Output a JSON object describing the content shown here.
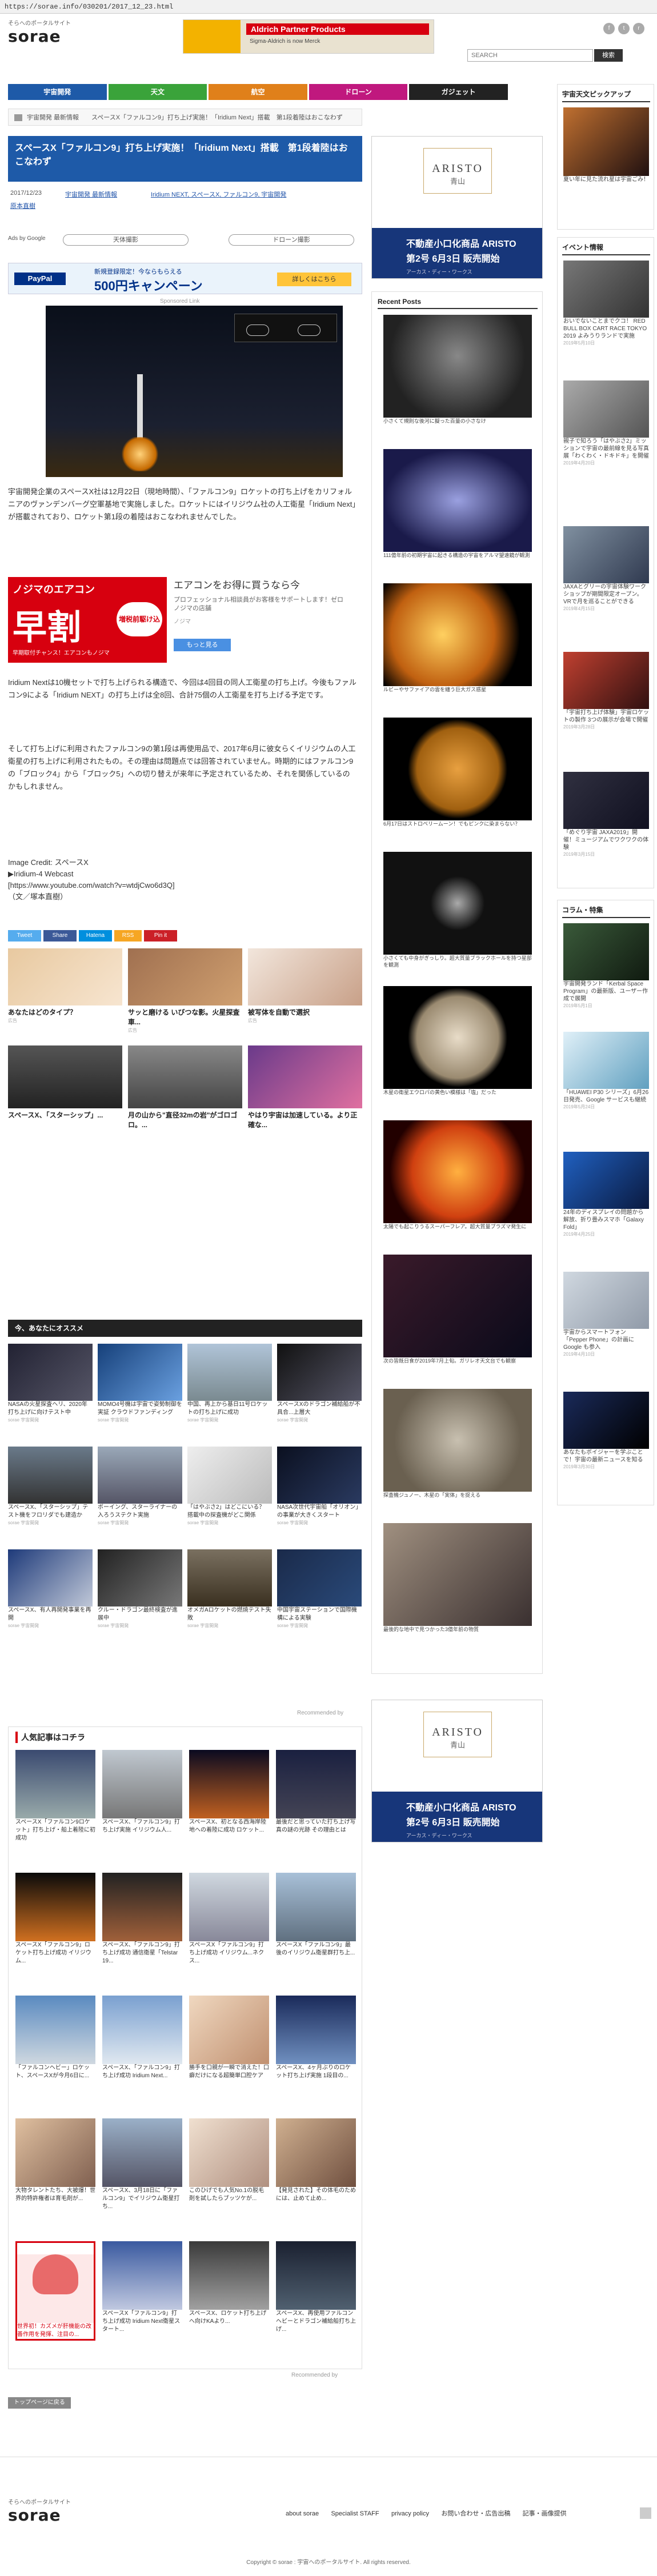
{
  "browser": {
    "url": "https://sorae.info/030201/2017_12_23.html"
  },
  "header": {
    "logo_sub": "そらへのポータルサイト",
    "logo": "sorae",
    "search_placeholder": "SEARCH",
    "search_button": "検索",
    "banner_title": "Aldrich Partner Products",
    "banner_sub": "Sigma-Aldrich is now Merck"
  },
  "nav": {
    "items": [
      {
        "label": "宇宙開発",
        "color": "#1e5aa8"
      },
      {
        "label": "天文",
        "color": "#3aa33a"
      },
      {
        "label": "航空",
        "color": "#e0801a"
      },
      {
        "label": "ドローン",
        "color": "#c0187e"
      },
      {
        "label": "ガジェット",
        "color": "#222222"
      }
    ]
  },
  "breadcrumb": "宇宙開発 最新情報　　スペースX「ファルコン9」打ち上げ実施！「Iridium Next」搭載　第1段着陸はおこなわず",
  "article": {
    "title": "スペースX「ファルコン9」打ち上げ実施！「Iridium Next」搭載　第1段着陸はおこなわず",
    "date": "2017/12/23",
    "category_label": "宇宙開発 最新情報",
    "tags": "Iridium NEXT, スペースX, ファルコン9, 宇宙開発",
    "author": "原本直樹",
    "ads_by_google": "Ads by Google",
    "pill1": "天体撮影",
    "pill2": "ドローン撮影",
    "paypal_text": "新規登録限定！今ならもらえる",
    "paypal_amount": "500円キャンペーン",
    "paypal_btn": "詳しくはこちら",
    "sponsored": "Sponsored Link",
    "p1": "宇宙開発企業のスペースX社は12月22日（現地時間）、「ファルコン9」ロケットの打ち上げをカリフォルニアのヴァンデンバーグ空軍基地で実施しました。ロケットにはイリジウム社の人工衛星「Iridium Next」が搭載されており、ロケット第1段の着陸はおこなわれませんでした。",
    "ad_red_line1": "ノジマのエアコン",
    "ad_red_line2": "早割",
    "ad_red_badge": "増税前駆け込み",
    "ad_red_foot": "早期取付チャンス！エアコンもノジマ",
    "ad_title": "エアコンをお得に買うなら今",
    "ad_desc": "プロフェッショナル相談員がお客様をサポートします！ゼロノジマの店舗",
    "ad_brand": "ノジマ",
    "ad_btn": "もっと見る",
    "p2": "Iridium Nextは10機セットで打ち上げられる構造で、今回は4回目の同人工衛星の打ち上げ。今後もファルコン9による「Iridium NEXT」の打ち上げは全8回、合計75個の人工衛星を打ち上げる予定です。",
    "p3": "そして打ち上げに利用されたファルコン9の第1段は再使用品で、2017年6月に彼女らくイリジウムの人工衛星の打ち上げに利用されたもの。その理由は問題点では回答されていません。時期的にはファルコン9の「ブロック4」から「ブロック5」への切り替えが来年に予定されているため、それを関係しているのかもしれません。",
    "credit": "Image Credit: スペースX",
    "webcast": "▶Iridium-4 Webcast",
    "youtube": "[https://www.youtube.com/watch?v=wtdjCwo6d3Q]",
    "signature": "（文／塚本直樹）"
  },
  "share": [
    {
      "label": "Tweet",
      "color": "#55acee"
    },
    {
      "label": "Share",
      "color": "#3b5998"
    },
    {
      "label": "Hatena",
      "color": "#008fde"
    },
    {
      "label": "RSS",
      "color": "#f6a623"
    },
    {
      "label": "Pin it",
      "color": "#cb2027"
    }
  ],
  "related_top": [
    {
      "caption": "あなたはどのタイプ？",
      "source": "広告"
    },
    {
      "caption": "サッと磨ける いびつな影。火星探査車...",
      "source": "広告"
    },
    {
      "caption": "被写体を自動で選択",
      "source": "広告"
    },
    {
      "caption": "スペースX、「スターシップ」...",
      "source": ""
    },
    {
      "caption": "月の山から\"直径32mの岩\"がゴロゴロ。...",
      "source": ""
    },
    {
      "caption": "やはり宇宙は加速している。より正確な...",
      "source": ""
    }
  ],
  "recommend_head": "今、あなたにオススメ",
  "recommend": [
    {
      "caption": "NASAの火星探査ヘリ、2020年打ち上げに向けテスト中",
      "source": "sorae 宇宙開発"
    },
    {
      "caption": "MOMO4号機は宇宙で姿勢制御を実証 クラウドファンディング",
      "source": "sorae 宇宙開発"
    },
    {
      "caption": "中国、再上から基日11号ロケットの打ち上げに成功",
      "source": "sorae 宇宙開発"
    },
    {
      "caption": "スペースXのドラゴン補給船が不具合...上層大",
      "source": "sorae 宇宙開発"
    },
    {
      "caption": "スペースX、「スターシップ」テスト機をフロリダでも建造か",
      "source": "sorae 宇宙開発"
    },
    {
      "caption": "ボーイング、スターライナーの入ろうステクト実施",
      "source": "sorae 宇宙開発"
    },
    {
      "caption": "「はやぶさ2」はどこにいる？ 搭載中の探査機がどこ関係",
      "source": "sorae 宇宙開発"
    },
    {
      "caption": "NASA次世代宇宙船「オリオン」の事業が大きくスタート",
      "source": "sorae 宇宙開発"
    },
    {
      "caption": "スペースX、有人再開発事業を再開",
      "source": "sorae 宇宙開発"
    },
    {
      "caption": "クルー・ドラゴン最終検査が進展中",
      "source": "sorae 宇宙開発"
    },
    {
      "caption": "オメガAロケットの燃焼テスト失敗",
      "source": "sorae 宇宙開発"
    },
    {
      "caption": "中国宇宙ステーションで国際機構による実験",
      "source": "sorae 宇宙開発"
    }
  ],
  "recommended_by": "Recommended by",
  "popular_head": "人気記事はコチラ",
  "popular": [
    {
      "caption": "スペースX「ファルコン9ロケット」打ち上げ・船上着陸に初成功"
    },
    {
      "caption": "スペースX、「ファルコン9」打ち上げ実施 イリジウム人..."
    },
    {
      "caption": "スペースX、初となる西海岸陸地への着陸に成功 ロケット..."
    },
    {
      "caption": "最後だと思っていた打ち上げ写真の謎の光跡 その理由とは"
    },
    {
      "caption": "スペースX「ファルコン9」ロケット打ち上げ成功 イリジウム..."
    },
    {
      "caption": "スペースX、「ファルコン9」打ち上げ成功 通信衛星「Telstar 19..."
    },
    {
      "caption": "スペースX「ファルコン9」打ち上げ成功 イリジウム...ネクス..."
    },
    {
      "caption": "スペースX「ファルコン9」最後のイリジウム衛星群打ち上..."
    },
    {
      "caption": "「ファルコンヘビー」ロケット、スペースXが今月6日に..."
    },
    {
      "caption": "スペースX、「ファルコン9」打ち上げ成功 Iridium Next..."
    },
    {
      "caption": "勝手を口親が一瞬で消えた！口癖だけになる超簡単口腔ケア"
    },
    {
      "caption": "スペースX、4ヶ月ぶりのロケット打ち上げ実施 1段目の..."
    },
    {
      "caption": "大物タレントたち、大被爆！世界的特許権者は育毛剤が..."
    },
    {
      "caption": "スペースX、3月18日に「ファルコン9」でイリジウム衛星打ち..."
    },
    {
      "caption": "このひげでも人気No.1の脱毛剤を試したらブッツケが..."
    },
    {
      "caption": "【発見された】その体毛のためには、止めて止め..."
    },
    {
      "caption": "世界初！カズメが肝機能の改善作用を発揮、注目の..."
    },
    {
      "caption": "スペースX「ファルコン9」打ち上げ成功 Iridium Next衛星スタート..."
    },
    {
      "caption": "スペースX、ロケット打ち上げへ向けKAより..."
    },
    {
      "caption": "スペースX、再使用ファルコンヘビーとドラゴン補給船打ち上げ..."
    }
  ],
  "recommended_by2": "Recommended by",
  "backtop": "トップページに戻る",
  "sidebar_ad": {
    "brand": "ARISTO",
    "sub": "青山",
    "line1": "不動産小口化商品 ARISTO",
    "line2": "第2号 6月3日 販売開始",
    "small": "アーカス・ディー・ワークス"
  },
  "recent_head": "Recent Posts",
  "recent": [
    {
      "caption": "小さくて規則な後河に擬った百量の小さなけ"
    },
    {
      "caption": "111億年前の初期宇宙に起きる構造の宇宙をアルマ望遠鏡が観測"
    },
    {
      "caption": "ルビーやサファイアの雲を纏う巨大ガス惑星"
    },
    {
      "caption": "6月17日はストロベリームーン！でもピンクに染まらない？"
    },
    {
      "caption": "小さくても中身がぎっしり。超大質量ブラックホールを持つ星部を観測"
    },
    {
      "caption": "木星の衛星エウロパの黄色い模様は「塩」だった"
    },
    {
      "caption": "太陽でも起こりうるスーパーフレア。超大質量プラズマ発生に"
    },
    {
      "caption": "次の皆既日食が2019年7月上旬。ガリレオ天文台でも観察"
    },
    {
      "caption": "探査機ジュノー、木星の「実体」を捉える"
    },
    {
      "caption": "最後的な地中で見つかった3億年前の物質"
    }
  ],
  "right": {
    "pickup_head": "宇宙天文ピックアップ",
    "pickup": [
      {
        "caption": "夏い年に見た流れ星は宇宙ごみ！",
        "date": ""
      }
    ],
    "event_head": "イベント情報",
    "events": [
      {
        "caption": "おいでないことまでクコ！ RED BULL BOX CART RACE TOKYO 2019 よみうりランドで実施",
        "date": "2019年5月10日"
      },
      {
        "caption": "親子で知ろう「はやぶさ2」ミッションで宇宙の最前線を見る写真展「わくわく・ドキドキ」を開催",
        "date": "2019年4月20日"
      },
      {
        "caption": "JAXAとグリーの宇宙体験ワークショップが期間限定オープン。VRで月を巡ることができる",
        "date": "2019年4月15日"
      },
      {
        "caption": "「宇宙打ち上げ体験」宇宙ロケットの製作 3つの展示が会場で開催",
        "date": "2019年3月28日"
      },
      {
        "caption": "「めぐり宇宙 JAXA2019」開催！ミュージアムでワクワクの体験",
        "date": "2019年3月15日"
      }
    ],
    "column_head": "コラム・特集",
    "columns": [
      {
        "caption": "宇宙開発ランド「Kerbal Space Program」の最新版、ユーザー作成で展開",
        "date": "2019年5月1日"
      },
      {
        "caption": "「HUAWEI P30 シリーズ」6月26日発売、Google サービスも継続",
        "date": "2019年5月24日"
      },
      {
        "caption": "24年のディスプレイの問題から解放、折り畳みスマホ「Galaxy Fold」",
        "date": "2019年4月25日"
      },
      {
        "caption": "宇宙からスマートフォン「Pepper Phone」の計画にGoogle も参入",
        "date": "2019年4月10日"
      },
      {
        "caption": "あなたもボイジャーを学ぶことで！宇宙の最新ニュースを知る",
        "date": "2019年3月30日"
      }
    ]
  },
  "footer": {
    "logo_sub": "そらへのポータルサイト",
    "logo": "sorae",
    "links": [
      "about sorae",
      "Specialist STAFF",
      "privacy policy",
      "お問い合わせ・広告出稿",
      "記事・画像提供"
    ],
    "copyright": "Copyright © sorae : 宇宙へのポータルサイト. All rights reserved."
  }
}
